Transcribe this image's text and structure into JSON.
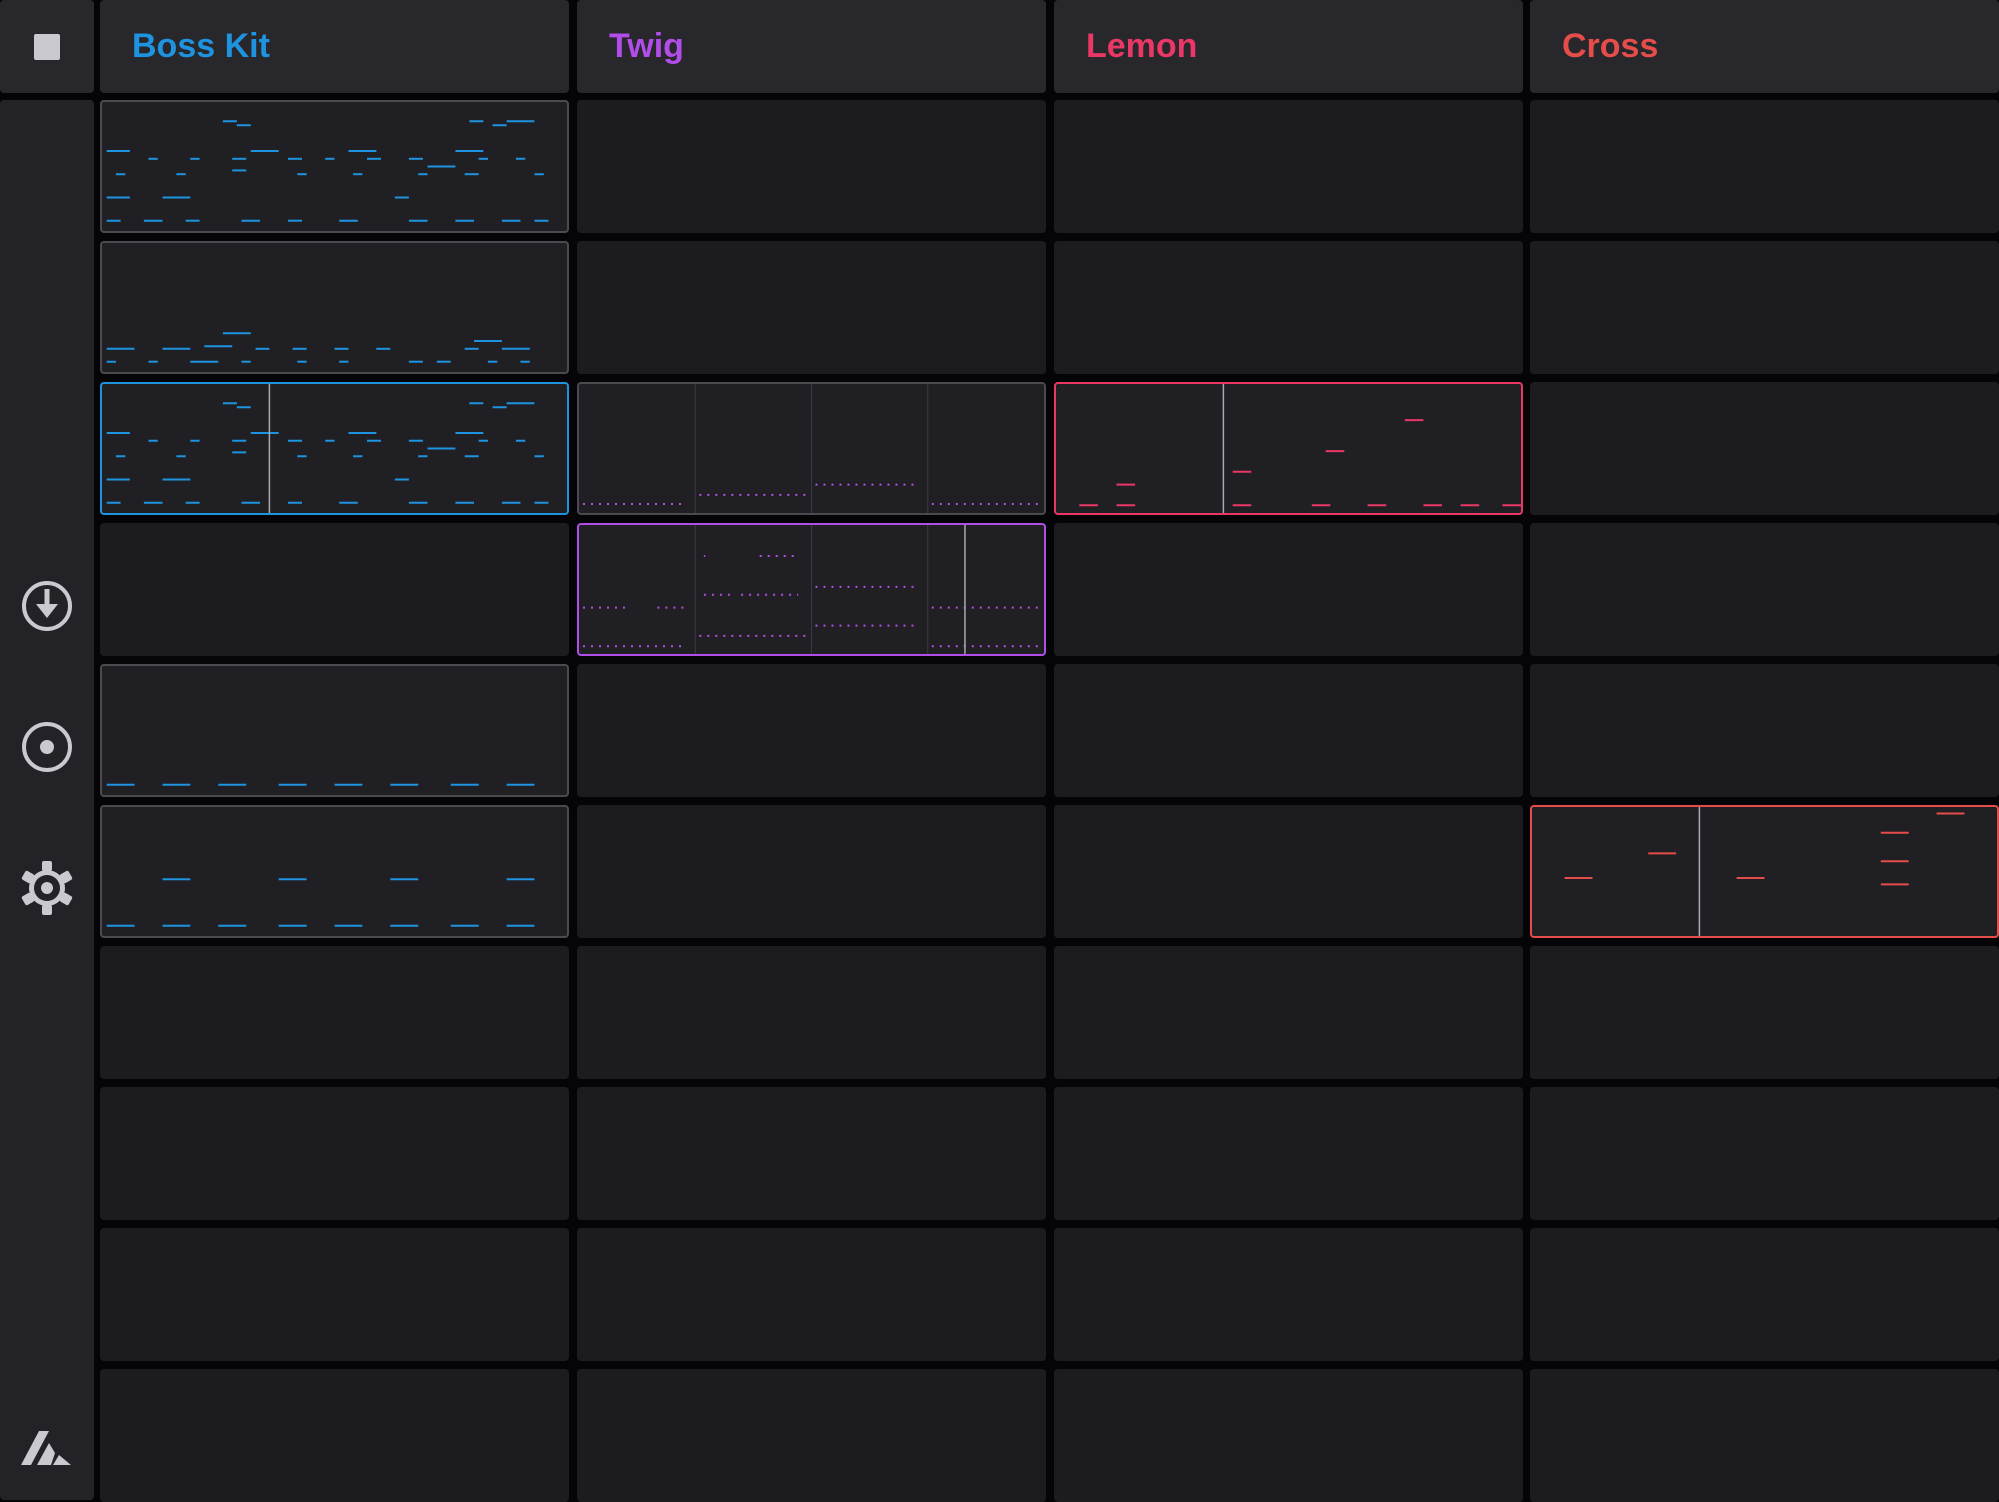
{
  "app": {
    "colors": {
      "background": "#050507",
      "panel": "#27272c",
      "slot": "#1c1c20",
      "clip_border": "#4a4a50"
    },
    "sidebar": {
      "stop_icon": "stop-icon",
      "buttons": [
        {
          "icon": "download-icon"
        },
        {
          "icon": "record-icon"
        },
        {
          "icon": "settings-gear-icon"
        },
        {
          "icon": "ableton-logo-icon"
        }
      ]
    },
    "tracks": [
      {
        "name": "Boss Kit",
        "color": "#1e93e0"
      },
      {
        "name": "Twig",
        "color": "#b14de8"
      },
      {
        "name": "Lemon",
        "color": "#ea3766"
      },
      {
        "name": "Cross",
        "color": "#e44d4a"
      }
    ],
    "scene_rows": 10,
    "clips": [
      {
        "track": 0,
        "scene": 0,
        "state": "stopped",
        "pattern": "drum_full"
      },
      {
        "track": 0,
        "scene": 1,
        "state": "stopped",
        "pattern": "drum_sparse"
      },
      {
        "track": 0,
        "scene": 2,
        "state": "playing",
        "pattern": "drum_full",
        "playhead": 0.36
      },
      {
        "track": 1,
        "scene": 2,
        "state": "stopped",
        "pattern": "twig_a"
      },
      {
        "track": 2,
        "scene": 2,
        "state": "playing",
        "pattern": "lemon",
        "playhead": 0.36
      },
      {
        "track": 1,
        "scene": 3,
        "state": "playing",
        "pattern": "twig_b",
        "playhead": 0.83
      },
      {
        "track": 0,
        "scene": 4,
        "state": "stopped",
        "pattern": "kick"
      },
      {
        "track": 0,
        "scene": 5,
        "state": "stopped",
        "pattern": "kick_hat"
      },
      {
        "track": 3,
        "scene": 5,
        "state": "playing",
        "pattern": "cross",
        "playhead": 0.36
      }
    ]
  }
}
